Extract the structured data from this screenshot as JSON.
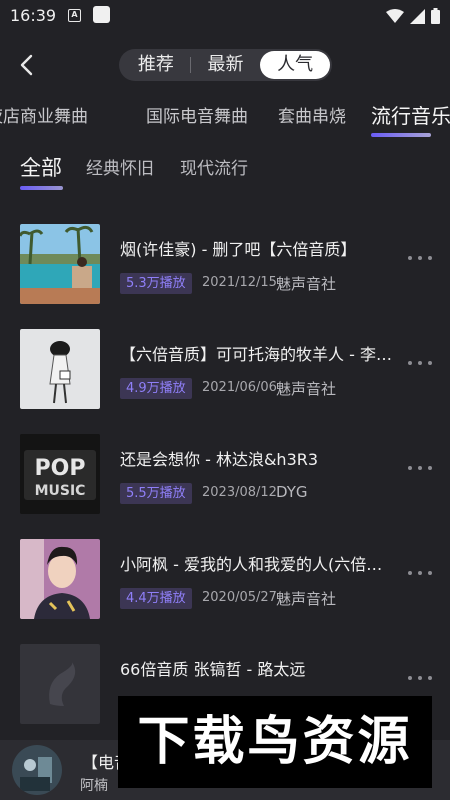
{
  "status": {
    "time": "16:39",
    "notif_letter": "A"
  },
  "header": {
    "tabs": [
      "推荐",
      "最新",
      "人气"
    ],
    "active_tab": "人气"
  },
  "categories": [
    "夜店商业舞曲",
    "国际电音舞曲",
    "套曲串烧",
    "流行音乐"
  ],
  "active_category": "流行音乐",
  "subtabs": [
    "全部",
    "经典怀旧",
    "现代流行"
  ],
  "active_subtab": "全部",
  "songs": [
    {
      "title": "烟(许佳豪) - 删了吧【六倍音质】",
      "plays": "5.3万播放",
      "date": "2021/12/15",
      "author": "魅声音社",
      "cover_icon": "pool-resort-cover"
    },
    {
      "title": "【六倍音质】可可托海的牧羊人 - 李维瑶",
      "plays": "4.9万播放",
      "date": "2021/06/06",
      "author": "魅声音社",
      "cover_icon": "girl-sketch-cover"
    },
    {
      "title": "还是会想你 - 林达浪&h3R3",
      "plays": "5.5万播放",
      "date": "2023/08/12",
      "author": "DYG",
      "cover_icon": "pop-music-cover",
      "cover_text": [
        "POP",
        "MUSIC"
      ]
    },
    {
      "title": "小阿枫 - 爱我的人和我爱的人(六倍音质)",
      "plays": "4.4万播放",
      "date": "2020/05/27",
      "author": "魅声音社",
      "cover_icon": "singer-portrait-cover"
    },
    {
      "title": "66倍音质 张镐哲 - 路太远",
      "plays": "",
      "date": "",
      "author": "",
      "cover_icon": "placeholder-cover"
    }
  ],
  "player": {
    "title": "【电音",
    "artist": "阿楠"
  },
  "watermark": "下载鸟资源",
  "colors": {
    "background": "#222226",
    "accent": "#6a5cf5",
    "badge_bg": "#3c3654",
    "badge_text": "#8f7ff8"
  }
}
